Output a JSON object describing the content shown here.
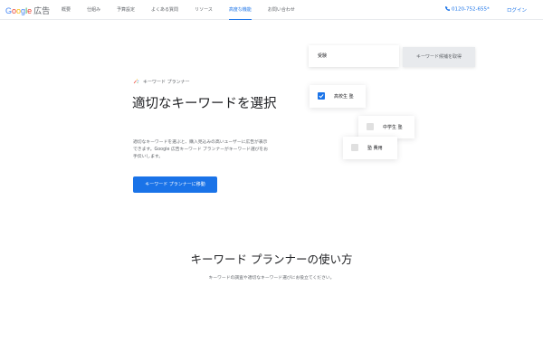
{
  "header": {
    "logo": {
      "letters": [
        "G",
        "o",
        "o",
        "g",
        "l",
        "e"
      ],
      "product": "広告"
    },
    "nav": [
      {
        "label": "概要",
        "active": false
      },
      {
        "label": "仕組み",
        "active": false
      },
      {
        "label": "予算設定",
        "active": false
      },
      {
        "label": "よくある質問",
        "active": false
      },
      {
        "label": "リソース",
        "active": false
      },
      {
        "label": "高度な機能",
        "active": true
      },
      {
        "label": "お問い合わせ",
        "active": false
      }
    ],
    "phone": "0120-752-655*",
    "login": "ログイン"
  },
  "hero": {
    "eyebrow": "キーワード プランナー",
    "title": "適切なキーワードを選択",
    "description": "適切なキーワードを選ぶと、購入見込みの高いユーザーに広告が表示できます。Google 広告キーワード プランナーがキーワード選びをお手伝いします。",
    "cta": "キーワード プランナーに移動"
  },
  "mock": {
    "search_value": "受験",
    "get_button": "キーワード候補を取得",
    "keywords": [
      {
        "label": "高校生 塾",
        "checked": true
      },
      {
        "label": "中学生 塾",
        "checked": false
      },
      {
        "label": "塾 費用",
        "checked": false
      }
    ]
  },
  "section": {
    "title": "キーワード プランナーの使い方",
    "description": "キーワードの調査や適切なキーワード選びにお役立てください。"
  },
  "colors": {
    "accent": "#1a73e8",
    "text": "#202124",
    "muted": "#5f6368"
  }
}
